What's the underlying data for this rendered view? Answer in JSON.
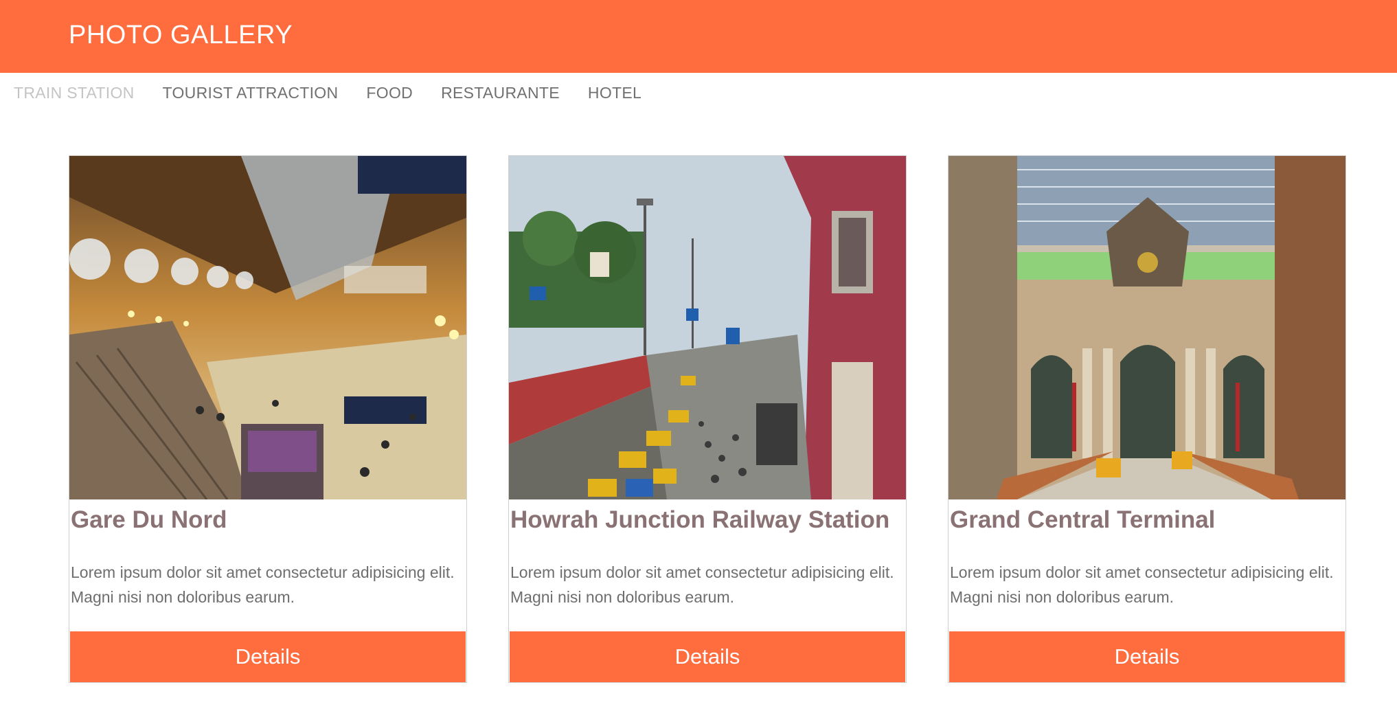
{
  "header": {
    "title": "PHOTO GALLERY",
    "brand_color": "#ff6c3e"
  },
  "nav": {
    "items": [
      {
        "label": "TRAIN STATION",
        "active": true
      },
      {
        "label": "TOURIST ATTRACTION",
        "active": false
      },
      {
        "label": "FOOD",
        "active": false
      },
      {
        "label": "RESTAURANTE",
        "active": false
      },
      {
        "label": "HOTEL",
        "active": false
      }
    ]
  },
  "cards": [
    {
      "title": "Gare Du Nord",
      "description": "Lorem ipsum dolor sit amet consectetur adipisicing elit. Magni nisi non doloribus earum.",
      "button_label": "Details",
      "image": "photo of a train station hall"
    },
    {
      "title": "Howrah Junction Railway Station",
      "description": "Lorem ipsum dolor sit amet consectetur adipisicing elit. Magni nisi non doloribus earum.",
      "button_label": "Details",
      "image": "photo of a busy street outside a red railway station"
    },
    {
      "title": "Grand Central Terminal",
      "description": "Lorem ipsum dolor sit amet consectetur adipisicing elit. Magni nisi non doloribus earum.",
      "button_label": "Details",
      "image": "photo of a terminal facade with arched windows"
    }
  ]
}
